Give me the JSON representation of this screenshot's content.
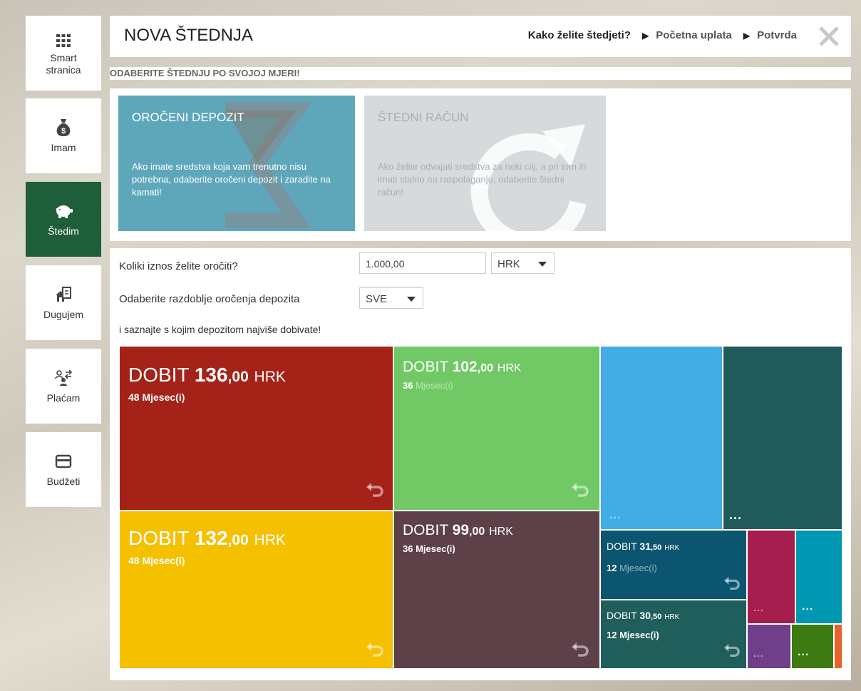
{
  "sidebar": {
    "items": [
      {
        "label_line1": "Smart",
        "label_line2": "stranica",
        "icon": "grid-icon",
        "active": false
      },
      {
        "label": "Imam",
        "icon": "money-bag-icon",
        "active": false
      },
      {
        "label": "Štedim",
        "icon": "piggy-bank-icon",
        "active": true
      },
      {
        "label": "Dugujem",
        "icon": "house-debt-icon",
        "active": false
      },
      {
        "label": "Plaćam",
        "icon": "transfer-people-icon",
        "active": false
      },
      {
        "label": "Budžeti",
        "icon": "card-icon",
        "active": false
      }
    ]
  },
  "header": {
    "title": "NOVA ŠTEDNJA",
    "steps": [
      "Kako želite štedjeti?",
      "Početna uplata",
      "Potvrda"
    ],
    "close_icon": "close-icon"
  },
  "subtitle": "ODABERITE ŠTEDNJU PO SVOJOJ MJERI!",
  "options": [
    {
      "title": "OROČENI DEPOZIT",
      "description": "Ako imate sredstva koja vam trenutno nisu potrebna, odaberite oročeni depozit i zaradite na kamati!",
      "color": "#5ea7bb"
    },
    {
      "title": "ŠTEDNI RAČUN",
      "description": "Ako želite odvajati sredstva za neki cilj, a pri tom ih imati stalno na raspolaganju, odaberite štedni račun!",
      "color": "#d7dadc"
    }
  ],
  "form": {
    "amount_label": "Koliki iznos želite oročiti?",
    "amount_value": "1.000,00",
    "currency": "HRK",
    "period_label": "Odaberite razdoblje oročenja depozita",
    "period_value": "SVE",
    "hint": "i saznajte s kojim depozitom najviše dobivate!"
  },
  "deposits": {
    "prefix": "DOBIT",
    "currency": "HRK",
    "months_word": "Mjesec(i)",
    "more": "...",
    "tiles": [
      {
        "int": "136",
        "dec": ",00",
        "months": "48",
        "color": "#a52219"
      },
      {
        "int": "102",
        "dec": ",00",
        "months": "36",
        "color": "#70c964"
      },
      {
        "int": "132",
        "dec": ",00",
        "months": "48",
        "color": "#f5c000"
      },
      {
        "int": "99",
        "dec": ",00",
        "months": "36",
        "color": "#5e4048"
      },
      {
        "int": "31",
        "dec": ",50",
        "months": "12",
        "color": "#0c5570"
      },
      {
        "int": "30",
        "dec": ",50",
        "months": "12",
        "color": "#1f5e5a"
      }
    ],
    "small_colors": [
      "#41ade4",
      "#215a5a",
      "#a61e4d",
      "#0097b2",
      "#6f3f8a",
      "#3d7a12",
      "#e8632c"
    ]
  }
}
